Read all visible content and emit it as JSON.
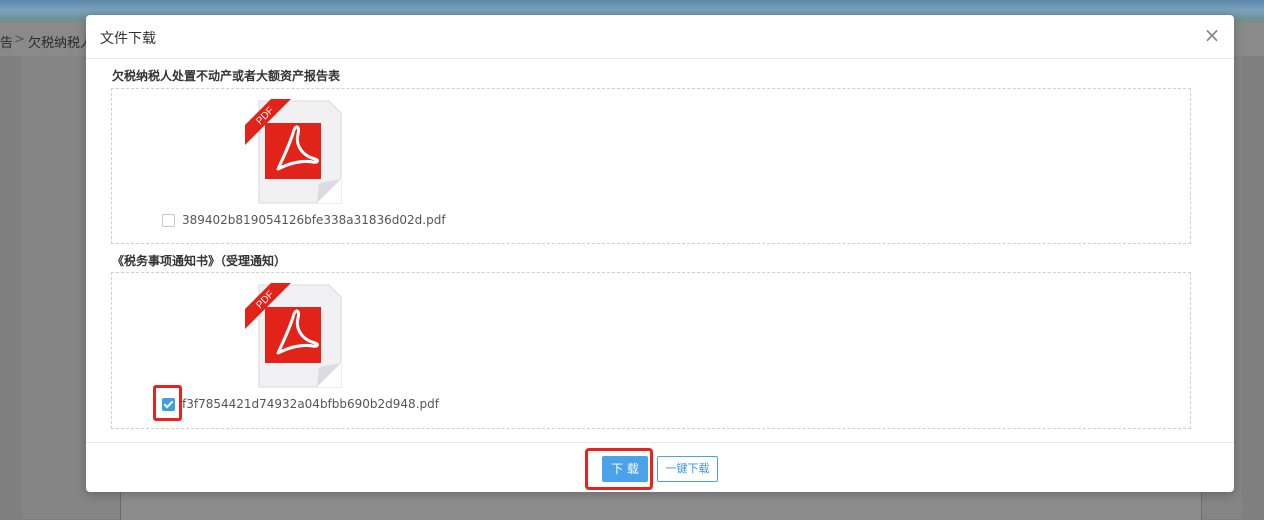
{
  "background": {
    "breadcrumb": {
      "left_fragment": "告",
      "separator": ">",
      "current_fragment": "欠税纳税人"
    }
  },
  "modal": {
    "title": "文件下载",
    "close_label": "×",
    "sections": [
      {
        "title": "欠税纳税人处置不动产或者大额资产报告表",
        "file_name": "389402b819054126bfe338a31836d02d.pdf",
        "checked": false
      },
      {
        "title": "《税务事项通知书》（受理通知）",
        "file_name": "f3f7854421d74932a04bfbb690b2d948.pdf",
        "checked": true
      }
    ],
    "footer": {
      "download_label": "下 载",
      "download_all_label": "一键下载"
    }
  },
  "colors": {
    "accent": "#4aa3e8",
    "highlight": "#e8231f",
    "pdf_red": "#e2231a"
  }
}
